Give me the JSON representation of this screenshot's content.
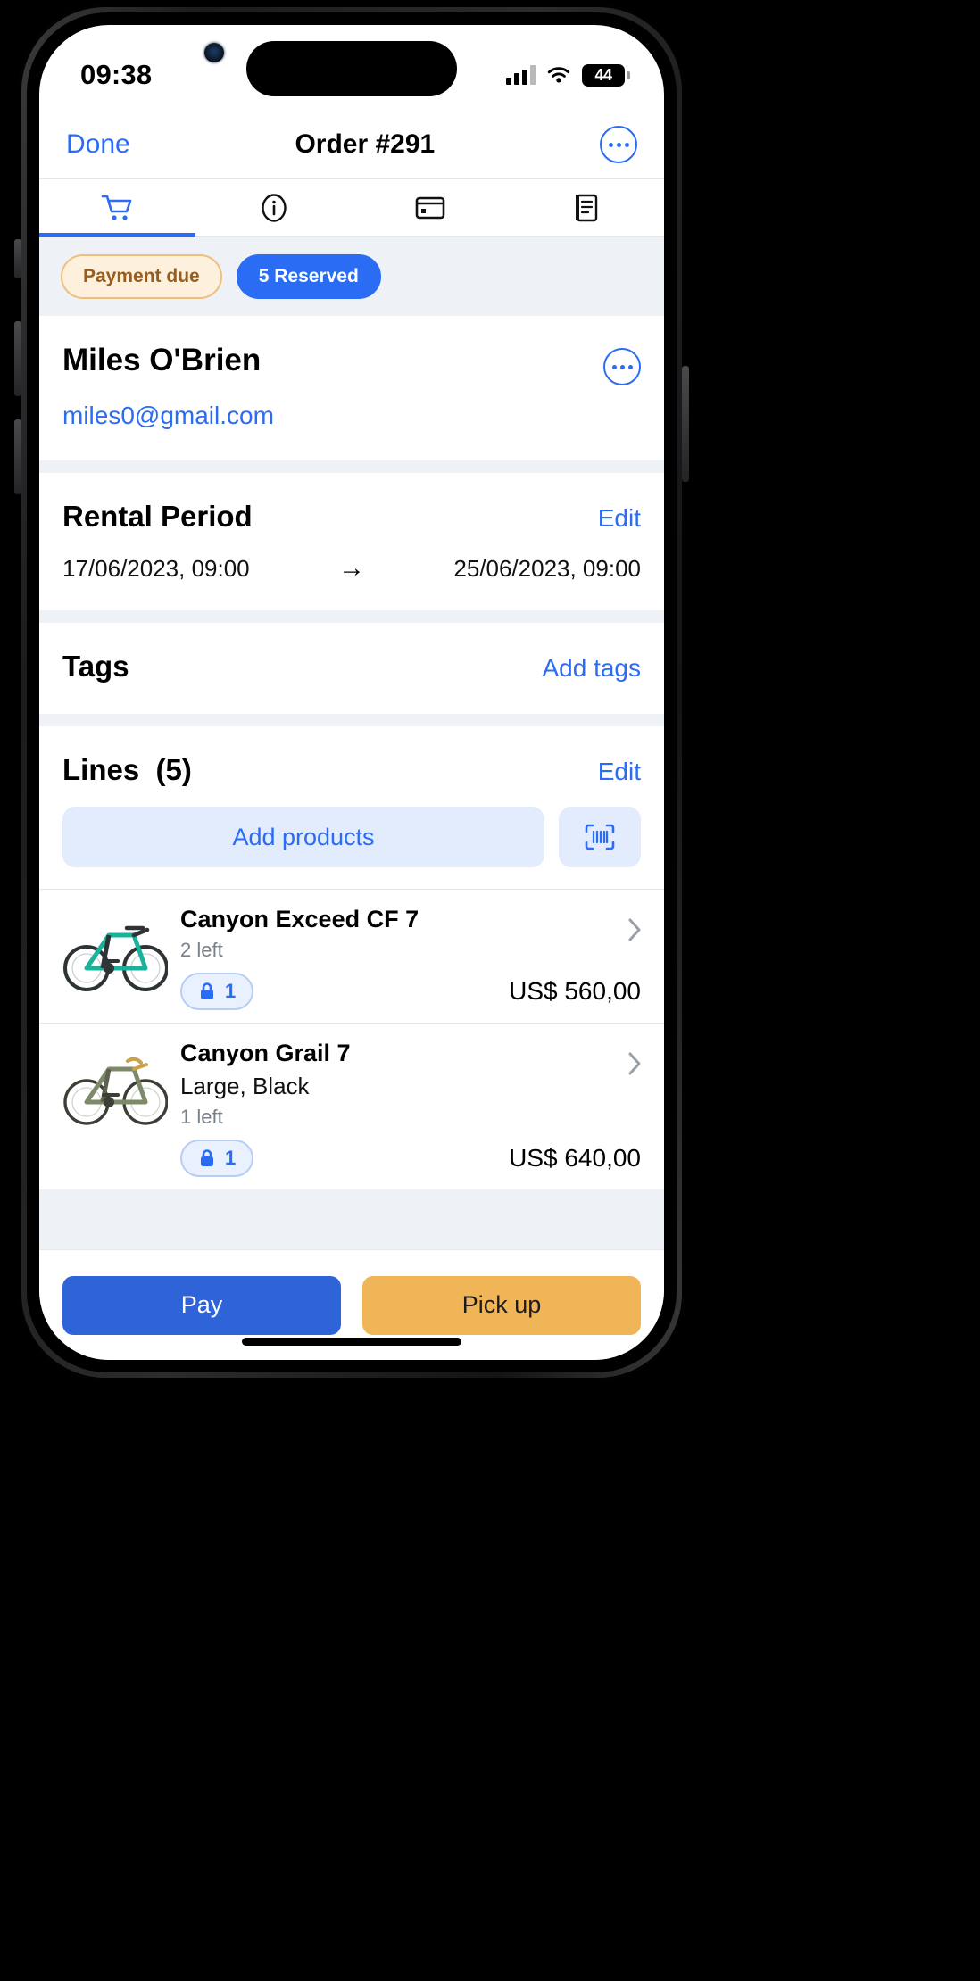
{
  "status_bar": {
    "time": "09:38",
    "battery_level": "44",
    "signal_icon": "cellular-bars-icon",
    "wifi_icon": "wifi-icon",
    "battery_icon": "battery-icon"
  },
  "nav": {
    "done_label": "Done",
    "title": "Order #291",
    "more_icon": "ellipsis-circle-icon"
  },
  "tabs": [
    {
      "name": "cart",
      "icon": "shopping-cart-icon",
      "active": true
    },
    {
      "name": "info",
      "icon": "info-circle-icon",
      "active": false
    },
    {
      "name": "payment",
      "icon": "credit-card-icon",
      "active": false
    },
    {
      "name": "documents",
      "icon": "document-icon",
      "active": false
    }
  ],
  "chips": [
    {
      "label": "Payment due",
      "style": "warn",
      "color": "#9a5c1a"
    },
    {
      "label": "5 Reserved",
      "style": "info",
      "color": "#2b6cf5"
    }
  ],
  "customer": {
    "name": "Miles O'Brien",
    "email": "miles0@gmail.com",
    "more_icon": "ellipsis-circle-icon"
  },
  "rental_period": {
    "title": "Rental Period",
    "edit_label": "Edit",
    "start": "17/06/2023, 09:00",
    "end": "25/06/2023, 09:00",
    "arrow": "→"
  },
  "tags": {
    "title": "Tags",
    "add_label": "Add tags"
  },
  "lines": {
    "title": "Lines",
    "count": "(5)",
    "edit_label": "Edit",
    "add_products_label": "Add products",
    "scan_icon": "barcode-scan-icon",
    "items": [
      {
        "name": "Canyon Exceed CF 7",
        "variant": "",
        "stock": "2 left",
        "reserved_qty": "1",
        "lock_icon": "lock-icon",
        "price": "US$ 560,00",
        "chevron_icon": "chevron-right-icon",
        "thumb": "mountain-bike-teal"
      },
      {
        "name": "Canyon Grail 7",
        "variant": "Large, Black",
        "stock": "1 left",
        "reserved_qty": "1",
        "lock_icon": "lock-icon",
        "price": "US$ 640,00",
        "chevron_icon": "chevron-right-icon",
        "thumb": "gravel-bike-olive"
      }
    ]
  },
  "actions": {
    "pay_label": "Pay",
    "pay_color": "#2f63d8",
    "pickup_label": "Pick up",
    "pickup_color": "#efb557"
  }
}
